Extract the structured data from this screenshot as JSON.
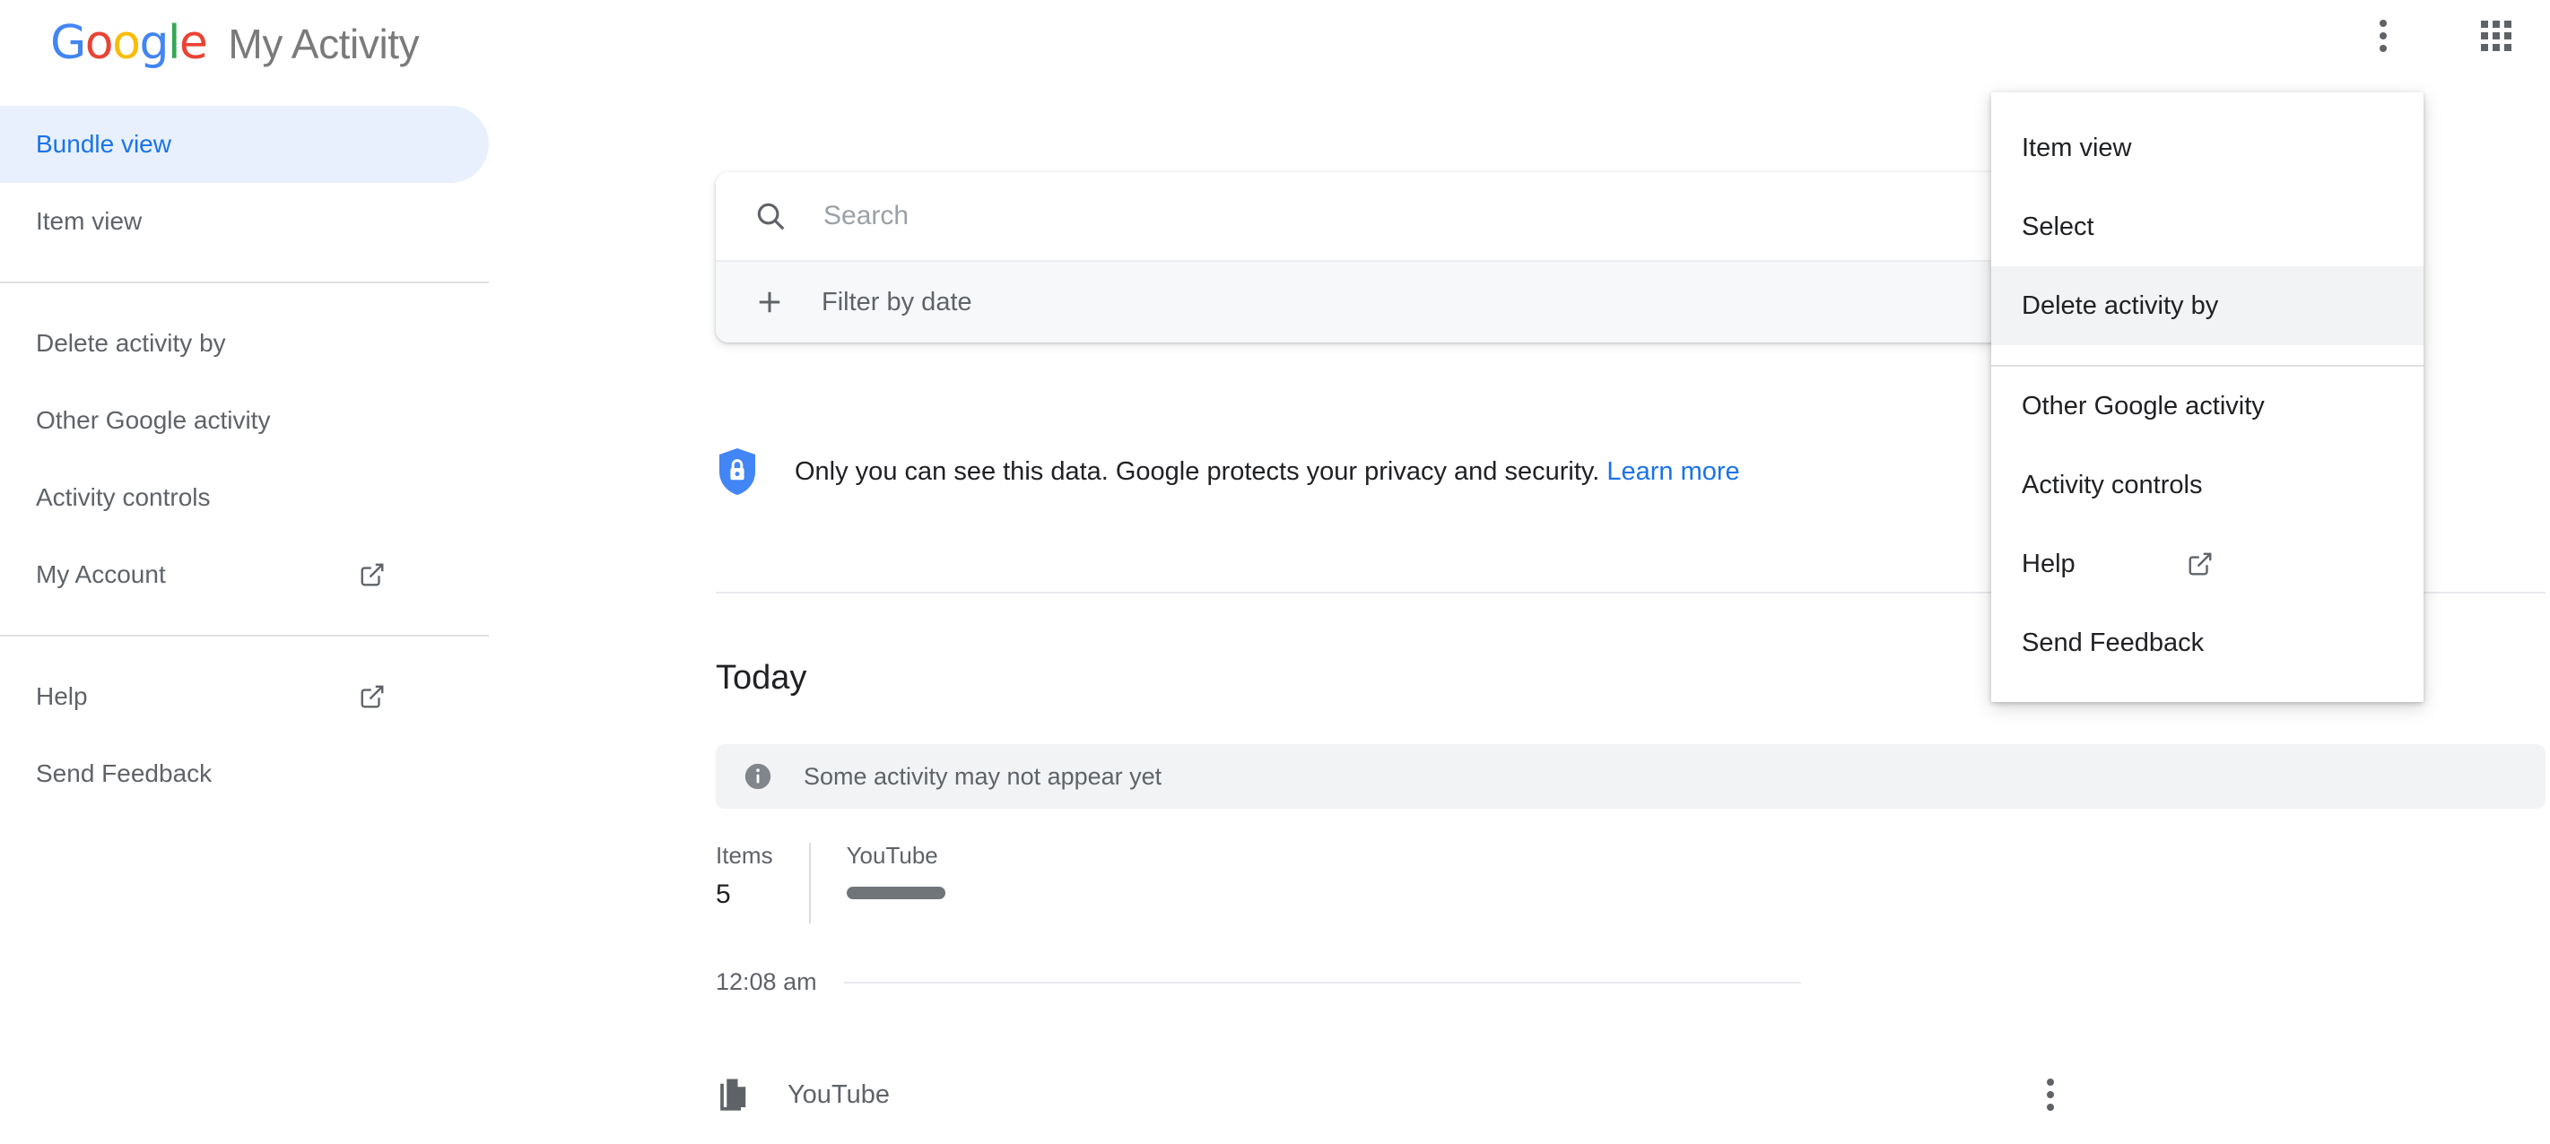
{
  "header": {
    "logo_text": "Google",
    "logo_letters": [
      {
        "char": "G",
        "color": "#4285F4"
      },
      {
        "char": "o",
        "color": "#EA4335"
      },
      {
        "char": "o",
        "color": "#FBBC05"
      },
      {
        "char": "g",
        "color": "#4285F4"
      },
      {
        "char": "l",
        "color": "#34A853"
      },
      {
        "char": "e",
        "color": "#EA4335"
      }
    ],
    "product_name": "My Activity",
    "more_options_icon": "kebab-menu-icon",
    "apps_icon": "apps-grid-icon"
  },
  "sidebar": {
    "items": [
      {
        "label": "Bundle view",
        "active": true,
        "external": false
      },
      {
        "label": "Item view",
        "active": false,
        "external": false
      },
      {
        "label": "Delete activity by",
        "active": false,
        "external": false
      },
      {
        "label": "Other Google activity",
        "active": false,
        "external": false
      },
      {
        "label": "Activity controls",
        "active": false,
        "external": false
      },
      {
        "label": "My Account",
        "active": false,
        "external": true
      },
      {
        "label": "Help",
        "active": false,
        "external": true
      },
      {
        "label": "Send Feedback",
        "active": false,
        "external": false
      }
    ]
  },
  "search": {
    "icon": "search-icon",
    "placeholder": "Search",
    "value": "",
    "filter_icon": "plus-icon",
    "filter_label": "Filter by date"
  },
  "privacy": {
    "icon": "shield-lock-icon",
    "text": "Only you can see this data. Google protects your privacy and security.",
    "link_label": "Learn more",
    "link_color": "#1a73e8"
  },
  "main": {
    "section_heading": "Today",
    "info_banner": {
      "icon": "info-icon",
      "text": "Some activity may not appear yet"
    },
    "stats": {
      "items_label": "Items",
      "items_value": "5",
      "product_label": "YouTube"
    },
    "timeline": [
      {
        "time": "12:08 am",
        "icon": "documents-copy-icon",
        "label": "YouTube",
        "menu_icon": "kebab-menu-icon"
      }
    ]
  },
  "overflow_menu": {
    "items": [
      {
        "label": "Item view",
        "highlight": false,
        "external": false,
        "divider_after": false
      },
      {
        "label": "Select",
        "highlight": false,
        "external": false,
        "divider_after": false
      },
      {
        "label": "Delete activity by",
        "highlight": true,
        "external": false,
        "divider_after": true
      },
      {
        "label": "Other Google activity",
        "highlight": false,
        "external": false,
        "divider_after": false
      },
      {
        "label": "Activity controls",
        "highlight": false,
        "external": false,
        "divider_after": false
      },
      {
        "label": "Help",
        "highlight": false,
        "external": true,
        "divider_after": false
      },
      {
        "label": "Send Feedback",
        "highlight": false,
        "external": false,
        "divider_after": false
      }
    ]
  },
  "colors": {
    "accent": "#1a73e8",
    "active_pill_bg": "#e8f0fe",
    "text_primary": "#202124",
    "text_secondary": "#5f6368",
    "shield_blue": "#4285F4"
  }
}
